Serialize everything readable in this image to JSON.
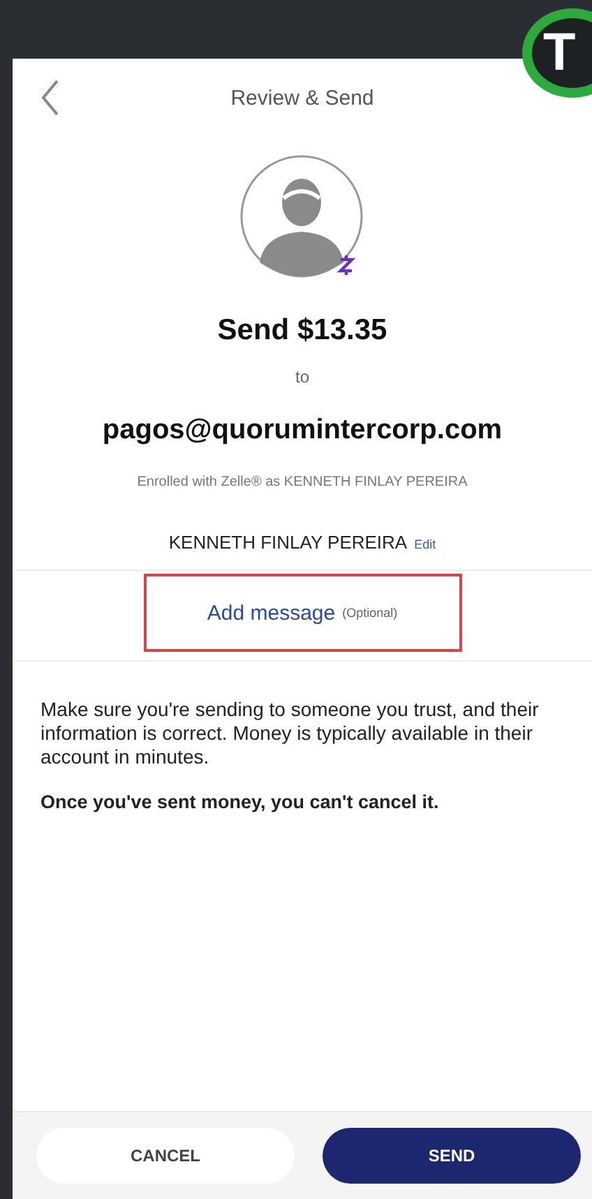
{
  "corner_badge": {
    "letter": "T"
  },
  "header": {
    "title": "Review & Send"
  },
  "recipient": {
    "amount_line": "Send $13.35",
    "to": "to",
    "email": "pagos@quorumintercorp.com",
    "enrolled": "Enrolled with Zelle® as KENNETH FINLAY PEREIRA",
    "name": "KENNETH FINLAY PEREIRA",
    "edit": "Edit"
  },
  "message": {
    "label": "Add message",
    "optional": "(Optional)",
    "highlighted": true
  },
  "notice": {
    "body": "Make sure you're sending to someone you trust, and their information is correct. Money is typically available in their account in minutes.",
    "warning": "Once you've sent money, you can't cancel it."
  },
  "buttons": [
    {
      "label": "CANCEL",
      "kind": "secondary"
    },
    {
      "label": "SEND",
      "kind": "primary"
    }
  ]
}
